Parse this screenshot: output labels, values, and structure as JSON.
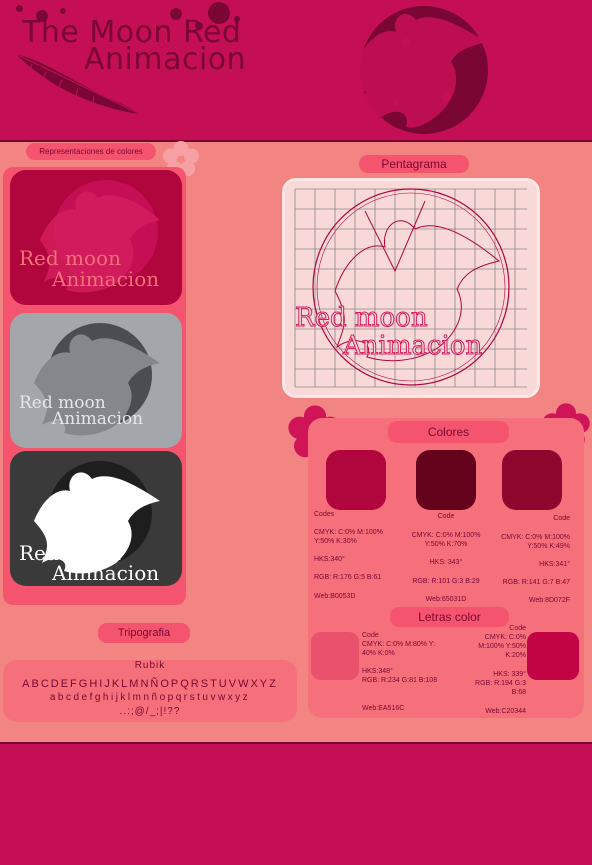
{
  "header": {
    "title_line1": "The Moon Red",
    "title_line2": "Animacion"
  },
  "left": {
    "section_label": "Representaciones de colores",
    "cards": [
      {
        "line1": "Red moon",
        "line2": "Animacion"
      },
      {
        "line1": "Red moon",
        "line2": "Animacion"
      },
      {
        "line1": "Red moon",
        "line2": "Animacion"
      }
    ]
  },
  "pentagrama": {
    "label": "Pentagrama",
    "logo_line1": "Red moon",
    "logo_line2": "Animacion"
  },
  "colores": {
    "label": "Colores",
    "swatches": [
      {
        "hex": "#B0053D",
        "code_label": "Codes",
        "cmyk": "CMYK: C:0% M:100% Y:50% K:30%",
        "hks": "HKS:340°",
        "rgb": "RGB: R:176 G:5 B:61",
        "web": "Web:B0053D"
      },
      {
        "hex": "#65031D",
        "code_label": "Code",
        "cmyk": "CMYK: C:0% M:100% Y:50% K:70%",
        "hks": "HKS: 343°",
        "rgb": "RGB: R:101 G:3 B:29",
        "web": "Web:65031D"
      },
      {
        "hex": "#8D072F",
        "code_label": "Code",
        "cmyk": "CMYK: C:0% M:100% Y:50% K:49%",
        "hks": "HKS:341°",
        "rgb": "RGB: R:141 G:7 B:47",
        "web": "Web:8D072F"
      }
    ]
  },
  "letras": {
    "label": "Letras color",
    "swatches": [
      {
        "hex": "#EA516C",
        "code_label": "Code",
        "cmyk": "CMYK: C:0% M:80% Y: 40% K:0%",
        "hks": "HKS:348°",
        "rgb": "RGB: R:234 G:81 B:108",
        "web": "Web:EA516C"
      },
      {
        "hex": "#C20344",
        "code_label": "Code",
        "cmyk": "CMYK: C:0% M:100% Y:50% K:20%",
        "hks": "HKS: 339°",
        "rgb": "RGB: R:194 G:3 B:68",
        "web": "Web:C20344"
      }
    ]
  },
  "tipografia": {
    "label": "Tripografia",
    "font_name": "Rubik",
    "uppercase": "ABCDEFGHIJKLMNÑOPQRSTUVWXYZ",
    "lowercase": "abcdefghijklmnñopqrstuvwxyz",
    "symbols": "..:;@/_;|!??"
  },
  "palette": {
    "background": "#F28482",
    "header": "#C40F55",
    "dark": "#7A0633",
    "panel": "#F5546E"
  }
}
